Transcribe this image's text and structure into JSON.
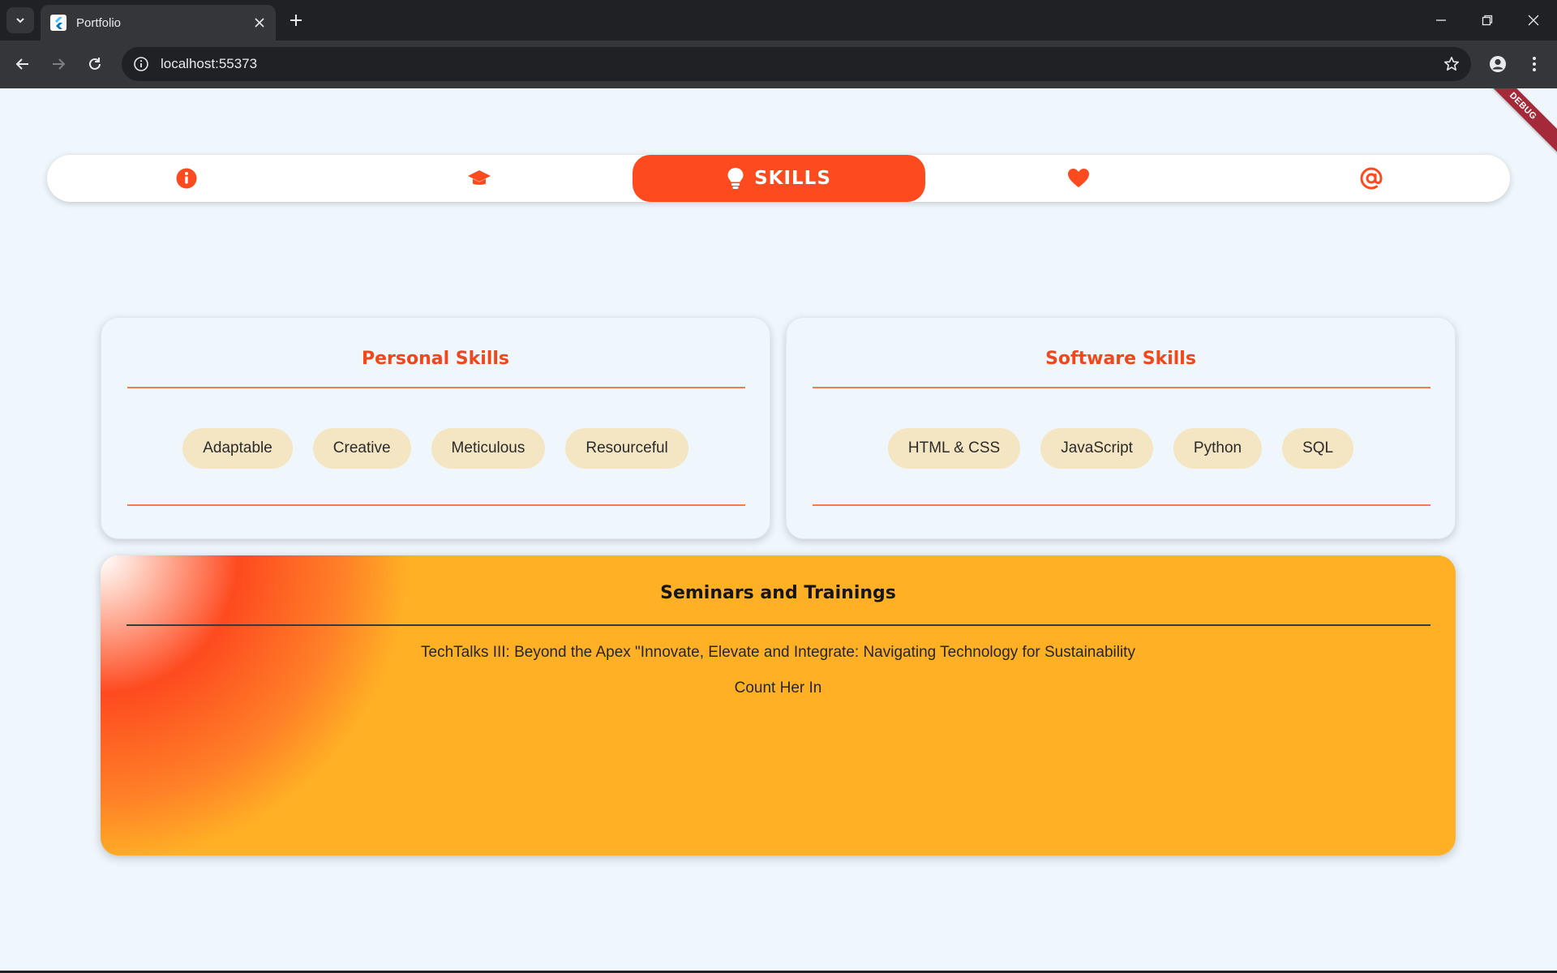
{
  "browser": {
    "tab_title": "Portfolio",
    "url": "localhost:55373",
    "icons": {
      "tab_search": "chevron-down-icon",
      "favicon": "flutter-icon",
      "tab_close": "close-icon",
      "new_tab": "plus-icon",
      "minimize": "minimize-icon",
      "restore": "restore-icon",
      "close_window": "close-icon",
      "back": "arrow-left-icon",
      "forward": "arrow-right-icon",
      "reload": "reload-icon",
      "site_info": "info-icon",
      "bookmark": "star-icon",
      "profile": "account-icon",
      "menu": "kebab-menu-icon"
    }
  },
  "page": {
    "debug_banner": "DEBUG",
    "nav": {
      "items": [
        {
          "icon": "info-icon"
        },
        {
          "icon": "graduation-cap-icon"
        },
        {
          "icon": "lightbulb-icon",
          "label": "SKILLS",
          "active": true
        },
        {
          "icon": "heart-icon"
        },
        {
          "icon": "at-sign-icon"
        }
      ]
    },
    "personal_skills": {
      "title": "Personal Skills",
      "chips": [
        "Adaptable",
        "Creative",
        "Meticulous",
        "Resourceful"
      ]
    },
    "software_skills": {
      "title": "Software Skills",
      "chips": [
        "HTML & CSS",
        "JavaScript",
        "Python",
        "SQL"
      ]
    },
    "seminars": {
      "title": "Seminars and Trainings",
      "items": [
        "TechTalks III: Beyond the Apex \"Innovate, Elevate and Integrate: Navigating Technology for Sustainability",
        "Count Her In"
      ]
    }
  },
  "colors": {
    "accent": "#fe4a1f",
    "chip_bg": "#f4e5c3",
    "page_bg": "#eff7fd",
    "seminar_bg": "#ffb025"
  }
}
